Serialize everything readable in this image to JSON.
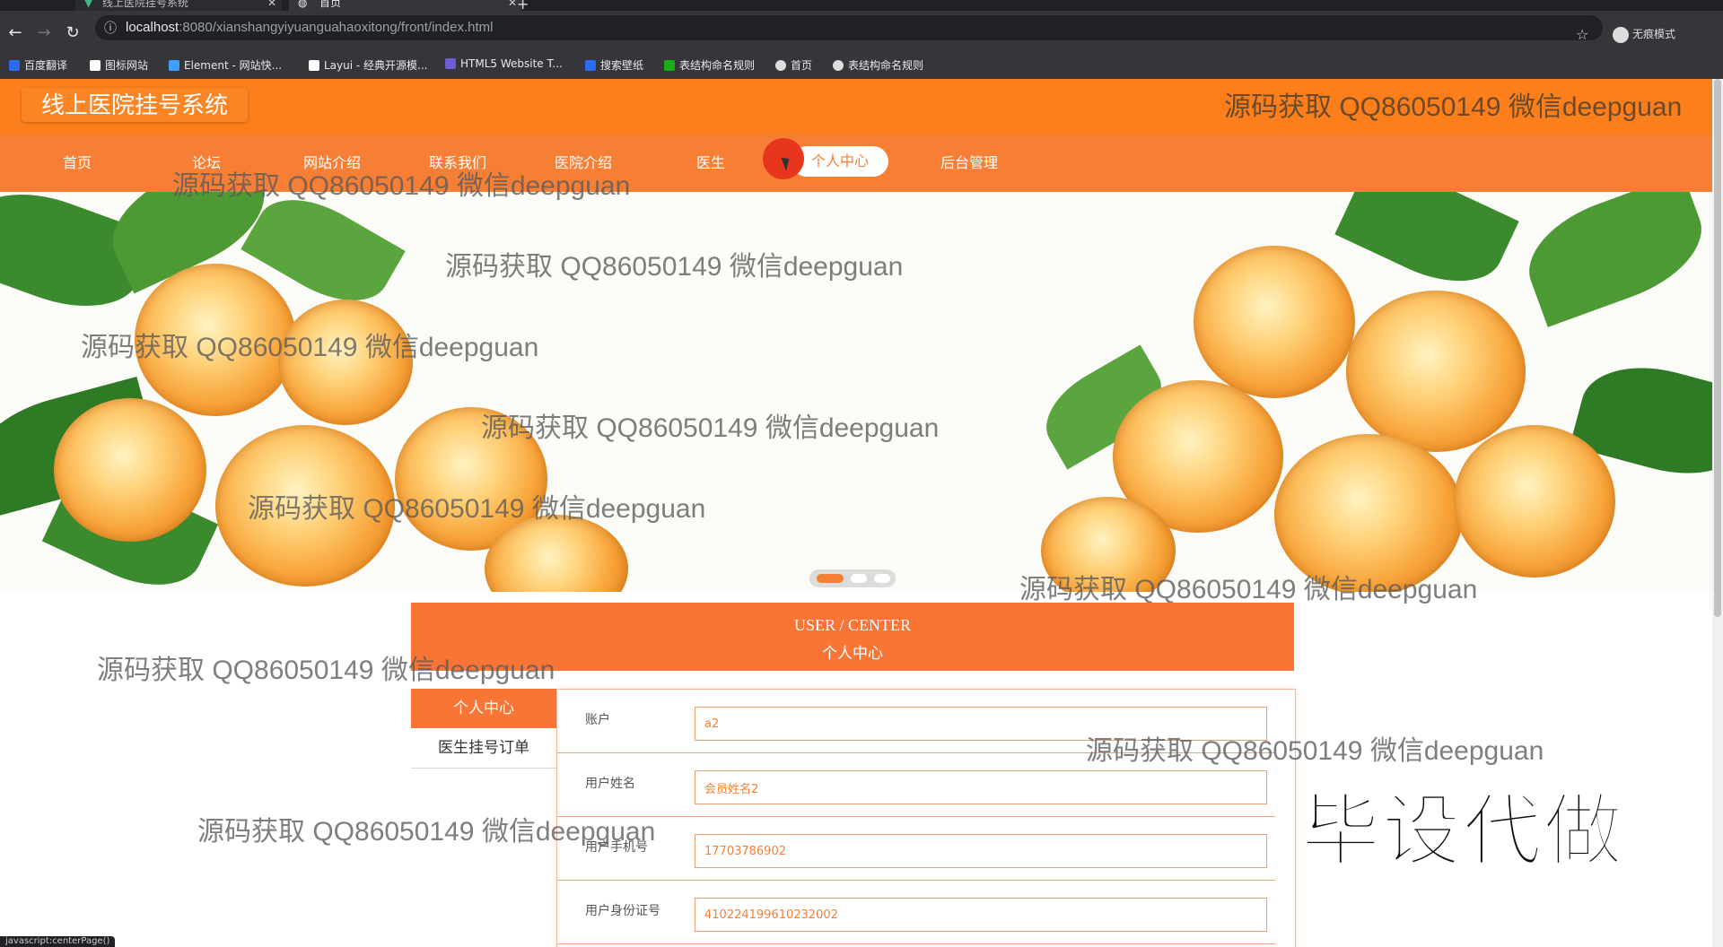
{
  "browser": {
    "tabs": [
      {
        "label": "线上医院挂号系统"
      },
      {
        "label": "首页"
      }
    ],
    "new_tab": "+",
    "url_host": "localhost",
    "url_path": ":8080/xianshangyiyuanguahaoxitong/front/index.html",
    "incognito_label": "无痕模式",
    "bookmarks": [
      {
        "label": "百度翻译",
        "color": "#2a6df4"
      },
      {
        "label": "图标网站",
        "color": "#ffffff"
      },
      {
        "label": "Element - 网站快...",
        "color": "#409eff"
      },
      {
        "label": "Layui - 经典开源模...",
        "color": "#ffffff"
      },
      {
        "label": "HTML5 Website T...",
        "color": "#6b5dd3"
      },
      {
        "label": "搜索壁纸",
        "color": "#2a6df4"
      },
      {
        "label": "表结构命名规则",
        "color": "#1aad19"
      },
      {
        "label": "首页",
        "color": "#dddddd"
      },
      {
        "label": "表结构命名规则",
        "color": "#dddddd"
      }
    ],
    "status_url": "javascript:centerPage()"
  },
  "header": {
    "logo": "线上医院挂号系统"
  },
  "nav": {
    "items": [
      {
        "label": "首页"
      },
      {
        "label": "论坛"
      },
      {
        "label": "网站介绍"
      },
      {
        "label": "联系我们"
      },
      {
        "label": "医院介绍"
      },
      {
        "label": "医生"
      },
      {
        "label": "个人中心"
      },
      {
        "label": "后台管理"
      }
    ],
    "active": "个人中心"
  },
  "carousel": {
    "slide_count": 3,
    "active_index": 0
  },
  "center": {
    "title_en": "USER / CENTER",
    "title_cn": "个人中心",
    "sidebar": [
      {
        "label": "个人中心"
      },
      {
        "label": "医生挂号订单"
      }
    ],
    "fields": [
      {
        "label": "账户",
        "value": "a2"
      },
      {
        "label": "用户姓名",
        "value": "会员姓名2"
      },
      {
        "label": "用户手机号",
        "value": "17703786902"
      },
      {
        "label": "用户身份证号",
        "value": "410224199610232002"
      }
    ]
  },
  "watermark": {
    "text": "源码获取 QQ86050149 微信deepguan"
  },
  "overlay": {
    "text": "毕设代做"
  },
  "colors": {
    "brand_orange": "#fc7f1c",
    "nav_orange": "#f67f35",
    "panel_orange": "#f97536"
  }
}
